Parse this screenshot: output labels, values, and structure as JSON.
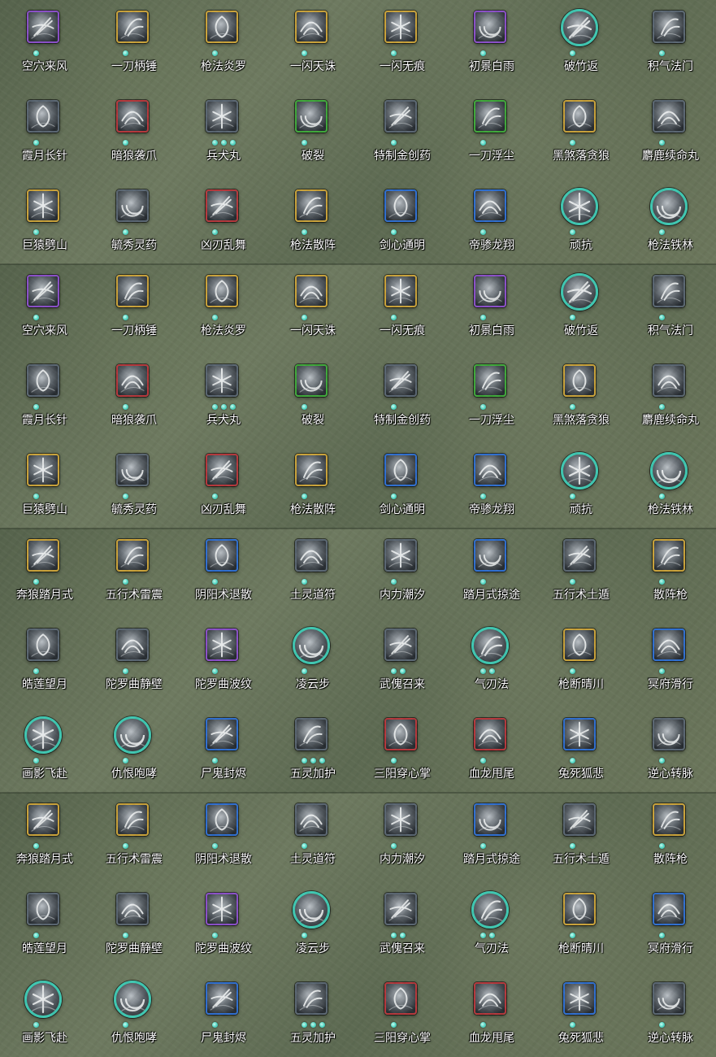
{
  "frame_colors": {
    "purple": "#8a4fc8",
    "gold": "#c9a23a",
    "red": "#b5383c",
    "green": "#3fa83a",
    "blue": "#2f6fd0",
    "teal": "#3fc7b1",
    "gray": "#5a6672"
  },
  "dot_color": "#4fd6c2",
  "panels": [
    {
      "rows": [
        [
          {
            "name": "空穴来风",
            "frame": "purple",
            "dots": 1,
            "icon": "vortex-coin-icon"
          },
          {
            "name": "一刀柄锤",
            "frame": "gold",
            "dots": 1,
            "icon": "blade-strike-icon"
          },
          {
            "name": "枪法炎罗",
            "frame": "gold",
            "dots": 1,
            "icon": "spear-flame-icon"
          },
          {
            "name": "一闪天诛",
            "frame": "gold",
            "dots": 1,
            "icon": "flash-slash-icon"
          },
          {
            "name": "一闪无痕",
            "frame": "gold",
            "dots": 1,
            "icon": "swift-cut-icon"
          },
          {
            "name": "初景白雨",
            "frame": "purple",
            "dots": 1,
            "icon": "light-pillar-icon"
          },
          {
            "name": "破竹返",
            "frame": "teal",
            "dots": 1,
            "icon": "counter-slash-icon"
          },
          {
            "name": "积气法门",
            "frame": "gray",
            "dots": 1,
            "icon": "qi-gather-icon"
          }
        ],
        [
          {
            "name": "霞月长针",
            "frame": "gray",
            "dots": 1,
            "icon": "needle-icon"
          },
          {
            "name": "暗狼袭爪",
            "frame": "red",
            "dots": 1,
            "icon": "wolf-claw-icon"
          },
          {
            "name": "兵犬丸",
            "frame": "gray",
            "dots": 3,
            "icon": "pill-hound-icon"
          },
          {
            "name": "破裂",
            "frame": "green",
            "dots": 1,
            "icon": "shatter-icon"
          },
          {
            "name": "特制金创药",
            "frame": "gray",
            "dots": 1,
            "icon": "medicine-icon"
          },
          {
            "name": "一刀浮尘",
            "frame": "green",
            "dots": 1,
            "icon": "dust-blade-icon"
          },
          {
            "name": "黑煞落贪狼",
            "frame": "gold",
            "dots": 1,
            "icon": "dark-wolf-icon"
          },
          {
            "name": "麝鹿续命丸",
            "frame": "gray",
            "dots": 1,
            "icon": "deer-pill-icon"
          }
        ],
        [
          {
            "name": "巨猿劈山",
            "frame": "gold",
            "dots": 1,
            "icon": "ape-smash-icon"
          },
          {
            "name": "毓秀灵药",
            "frame": "gray",
            "dots": 1,
            "icon": "gourd-icon"
          },
          {
            "name": "凶刃乱舞",
            "frame": "red",
            "dots": 1,
            "icon": "blade-dance-icon"
          },
          {
            "name": "枪法散阵",
            "frame": "gold",
            "dots": 1,
            "icon": "spear-scatter-icon"
          },
          {
            "name": "剑心通明",
            "frame": "blue",
            "dots": 1,
            "icon": "sword-heart-icon"
          },
          {
            "name": "帝骖龙翔",
            "frame": "blue",
            "dots": 1,
            "icon": "dragon-flight-icon"
          },
          {
            "name": "顽抗",
            "frame": "teal",
            "dots": 1,
            "icon": "resist-icon"
          },
          {
            "name": "枪法铁林",
            "frame": "teal",
            "dots": 1,
            "icon": "iron-forest-icon"
          }
        ]
      ]
    },
    {
      "rows": [
        [
          {
            "name": "空穴来风",
            "frame": "purple",
            "dots": 1,
            "icon": "vortex-coin-icon"
          },
          {
            "name": "一刀柄锤",
            "frame": "gold",
            "dots": 1,
            "icon": "blade-strike-icon"
          },
          {
            "name": "枪法炎罗",
            "frame": "gold",
            "dots": 1,
            "icon": "spear-flame-icon"
          },
          {
            "name": "一闪天诛",
            "frame": "gold",
            "dots": 1,
            "icon": "flash-slash-icon"
          },
          {
            "name": "一闪无痕",
            "frame": "gold",
            "dots": 1,
            "icon": "swift-cut-icon"
          },
          {
            "name": "初景白雨",
            "frame": "purple",
            "dots": 1,
            "icon": "light-pillar-icon"
          },
          {
            "name": "破竹返",
            "frame": "teal",
            "dots": 1,
            "icon": "counter-slash-icon"
          },
          {
            "name": "积气法门",
            "frame": "gray",
            "dots": 1,
            "icon": "qi-gather-icon"
          }
        ],
        [
          {
            "name": "霞月长针",
            "frame": "gray",
            "dots": 1,
            "icon": "needle-icon"
          },
          {
            "name": "暗狼袭爪",
            "frame": "red",
            "dots": 1,
            "icon": "wolf-claw-icon"
          },
          {
            "name": "兵犬丸",
            "frame": "gray",
            "dots": 3,
            "icon": "pill-hound-icon"
          },
          {
            "name": "破裂",
            "frame": "green",
            "dots": 1,
            "icon": "shatter-icon"
          },
          {
            "name": "特制金创药",
            "frame": "gray",
            "dots": 1,
            "icon": "medicine-icon"
          },
          {
            "name": "一刀浮尘",
            "frame": "green",
            "dots": 1,
            "icon": "dust-blade-icon"
          },
          {
            "name": "黑煞落贪狼",
            "frame": "gold",
            "dots": 1,
            "icon": "dark-wolf-icon"
          },
          {
            "name": "麝鹿续命丸",
            "frame": "gray",
            "dots": 1,
            "icon": "deer-pill-icon"
          }
        ],
        [
          {
            "name": "巨猿劈山",
            "frame": "gold",
            "dots": 1,
            "icon": "ape-smash-icon"
          },
          {
            "name": "毓秀灵药",
            "frame": "gray",
            "dots": 1,
            "icon": "gourd-icon"
          },
          {
            "name": "凶刃乱舞",
            "frame": "red",
            "dots": 1,
            "icon": "blade-dance-icon"
          },
          {
            "name": "枪法散阵",
            "frame": "gold",
            "dots": 1,
            "icon": "spear-scatter-icon"
          },
          {
            "name": "剑心通明",
            "frame": "blue",
            "dots": 1,
            "icon": "sword-heart-icon"
          },
          {
            "name": "帝骖龙翔",
            "frame": "blue",
            "dots": 1,
            "icon": "dragon-flight-icon"
          },
          {
            "name": "顽抗",
            "frame": "teal",
            "dots": 1,
            "icon": "resist-icon"
          },
          {
            "name": "枪法铁林",
            "frame": "teal",
            "dots": 1,
            "icon": "iron-forest-icon"
          }
        ]
      ]
    },
    {
      "rows": [
        [
          {
            "name": "奔狼踏月式",
            "frame": "gold",
            "dots": 1,
            "icon": "wolf-moon-icon"
          },
          {
            "name": "五行术雷震",
            "frame": "gold",
            "dots": 1,
            "icon": "thunder-icon"
          },
          {
            "name": "阴阳术退散",
            "frame": "blue",
            "dots": 1,
            "icon": "yinyang-icon"
          },
          {
            "name": "土灵道符",
            "frame": "gray",
            "dots": 1,
            "icon": "talisman-icon"
          },
          {
            "name": "内力潮汐",
            "frame": "gray",
            "dots": 1,
            "icon": "tide-icon"
          },
          {
            "name": "踏月式掠途",
            "frame": "blue",
            "dots": 1,
            "icon": "moon-dash-icon"
          },
          {
            "name": "五行术土遁",
            "frame": "gray",
            "dots": 1,
            "icon": "earth-escape-icon"
          },
          {
            "name": "散阵枪",
            "frame": "gold",
            "dots": 1,
            "icon": "scatter-spear-icon"
          }
        ],
        [
          {
            "name": "皓莲望月",
            "frame": "gray",
            "dots": 1,
            "icon": "crescent-icon"
          },
          {
            "name": "陀罗曲静壁",
            "frame": "gray",
            "dots": 1,
            "icon": "still-wall-icon"
          },
          {
            "name": "陀罗曲波纹",
            "frame": "purple",
            "dots": 1,
            "icon": "ripple-icon"
          },
          {
            "name": "凌云步",
            "frame": "teal",
            "dots": 1,
            "icon": "cloud-step-icon"
          },
          {
            "name": "武傀召来",
            "frame": "gray",
            "dots": 2,
            "icon": "puppet-icon"
          },
          {
            "name": "气刃法",
            "frame": "teal",
            "dots": 2,
            "icon": "air-blade-icon"
          },
          {
            "name": "枪断晴川",
            "frame": "gold",
            "dots": 1,
            "icon": "spear-break-icon"
          },
          {
            "name": "冥府滑行",
            "frame": "blue",
            "dots": 1,
            "icon": "underworld-glide-icon"
          }
        ],
        [
          {
            "name": "画影飞赴",
            "frame": "teal",
            "dots": 1,
            "icon": "shadow-leap-icon"
          },
          {
            "name": "仇恨咆哮",
            "frame": "teal",
            "dots": 1,
            "icon": "roar-icon"
          },
          {
            "name": "尸鬼封烬",
            "frame": "blue",
            "dots": 1,
            "icon": "ghost-seal-icon"
          },
          {
            "name": "五灵加护",
            "frame": "gray",
            "dots": 3,
            "icon": "five-spirit-icon"
          },
          {
            "name": "三阳穿心掌",
            "frame": "red",
            "dots": 1,
            "icon": "palm-strike-icon"
          },
          {
            "name": "血龙甩尾",
            "frame": "red",
            "dots": 1,
            "icon": "dragon-tail-icon"
          },
          {
            "name": "兔死狐悲",
            "frame": "blue",
            "dots": 1,
            "icon": "fox-mourn-icon"
          },
          {
            "name": "逆心转脉",
            "frame": "gray",
            "dots": 1,
            "icon": "meridian-icon"
          }
        ]
      ]
    },
    {
      "rows": [
        [
          {
            "name": "奔狼踏月式",
            "frame": "gold",
            "dots": 1,
            "icon": "wolf-moon-icon"
          },
          {
            "name": "五行术雷震",
            "frame": "gold",
            "dots": 1,
            "icon": "thunder-icon"
          },
          {
            "name": "阴阳术退散",
            "frame": "blue",
            "dots": 1,
            "icon": "yinyang-icon"
          },
          {
            "name": "土灵道符",
            "frame": "gray",
            "dots": 1,
            "icon": "talisman-icon"
          },
          {
            "name": "内力潮汐",
            "frame": "gray",
            "dots": 1,
            "icon": "tide-icon"
          },
          {
            "name": "踏月式掠途",
            "frame": "blue",
            "dots": 1,
            "icon": "moon-dash-icon"
          },
          {
            "name": "五行术土遁",
            "frame": "gray",
            "dots": 1,
            "icon": "earth-escape-icon"
          },
          {
            "name": "散阵枪",
            "frame": "gold",
            "dots": 1,
            "icon": "scatter-spear-icon"
          }
        ],
        [
          {
            "name": "皓莲望月",
            "frame": "gray",
            "dots": 1,
            "icon": "crescent-icon"
          },
          {
            "name": "陀罗曲静壁",
            "frame": "gray",
            "dots": 1,
            "icon": "still-wall-icon"
          },
          {
            "name": "陀罗曲波纹",
            "frame": "purple",
            "dots": 1,
            "icon": "ripple-icon"
          },
          {
            "name": "凌云步",
            "frame": "teal",
            "dots": 1,
            "icon": "cloud-step-icon"
          },
          {
            "name": "武傀召来",
            "frame": "gray",
            "dots": 2,
            "icon": "puppet-icon"
          },
          {
            "name": "气刃法",
            "frame": "teal",
            "dots": 2,
            "icon": "air-blade-icon"
          },
          {
            "name": "枪断晴川",
            "frame": "gold",
            "dots": 1,
            "icon": "spear-break-icon"
          },
          {
            "name": "冥府滑行",
            "frame": "blue",
            "dots": 1,
            "icon": "underworld-glide-icon"
          }
        ],
        [
          {
            "name": "画影飞赴",
            "frame": "teal",
            "dots": 1,
            "icon": "shadow-leap-icon"
          },
          {
            "name": "仇恨咆哮",
            "frame": "teal",
            "dots": 1,
            "icon": "roar-icon"
          },
          {
            "name": "尸鬼封烬",
            "frame": "blue",
            "dots": 1,
            "icon": "ghost-seal-icon"
          },
          {
            "name": "五灵加护",
            "frame": "gray",
            "dots": 3,
            "icon": "five-spirit-icon"
          },
          {
            "name": "三阳穿心掌",
            "frame": "red",
            "dots": 1,
            "icon": "palm-strike-icon"
          },
          {
            "name": "血龙甩尾",
            "frame": "red",
            "dots": 1,
            "icon": "dragon-tail-icon"
          },
          {
            "name": "兔死狐悲",
            "frame": "blue",
            "dots": 1,
            "icon": "fox-mourn-icon"
          },
          {
            "name": "逆心转脉",
            "frame": "gray",
            "dots": 1,
            "icon": "meridian-icon"
          }
        ]
      ]
    }
  ]
}
